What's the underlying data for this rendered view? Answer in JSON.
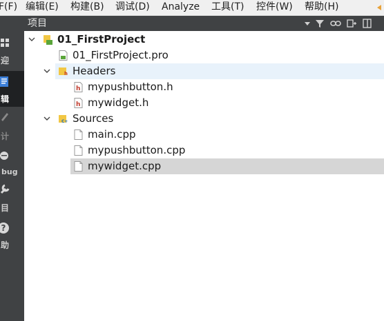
{
  "menubar": {
    "items": [
      {
        "label": "F(F)"
      },
      {
        "label": "编辑(E)"
      },
      {
        "label": "构建(B)"
      },
      {
        "label": "调试(D)"
      },
      {
        "label": "Analyze"
      },
      {
        "label": "工具(T)"
      },
      {
        "label": "控件(W)"
      },
      {
        "label": "帮助(H)"
      }
    ]
  },
  "modebar": {
    "items": [
      {
        "label": "迎",
        "icon": "grid-icon"
      },
      {
        "label": "辑",
        "icon": "edit-document-icon",
        "active": true
      },
      {
        "label": "计",
        "icon": "pencil-icon"
      },
      {
        "label": "bug",
        "icon": "bug-icon"
      },
      {
        "label": "目",
        "icon": "wrench-icon"
      },
      {
        "label": "助",
        "icon": "help-icon"
      }
    ]
  },
  "panel": {
    "title": "项目"
  },
  "tree": {
    "project": {
      "label": "01_FirstProject"
    },
    "pro_file": {
      "label": "01_FirstProject.pro"
    },
    "headers": {
      "label": "Headers",
      "files": [
        {
          "label": "mypushbutton.h"
        },
        {
          "label": "mywidget.h"
        }
      ]
    },
    "sources": {
      "label": "Sources",
      "files": [
        {
          "label": "main.cpp"
        },
        {
          "label": "mypushbutton.cpp"
        },
        {
          "label": "mywidget.cpp"
        }
      ]
    }
  },
  "colors": {
    "menubar_bg": "#f0f0f0",
    "sidebar_bg": "#404244",
    "sidebar_active_bg": "#1f2123",
    "header_bg": "#404244",
    "row_hover_bg": "#e8f2fb",
    "row_selected_bg": "#d6d6d6",
    "accent_blue": "#4a88c7"
  }
}
